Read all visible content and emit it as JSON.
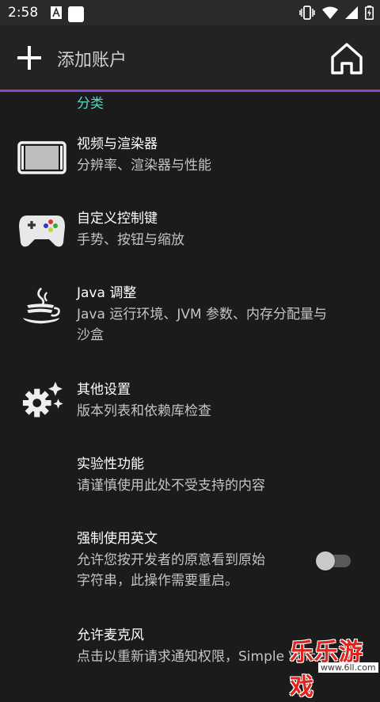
{
  "status_bar": {
    "time": "2:58"
  },
  "app_bar": {
    "title": "添加账户"
  },
  "category": "分类",
  "settings": [
    {
      "title": "视频与渲染器",
      "summary": "分辨率、渲染器与性能",
      "icon": "display-icon"
    },
    {
      "title": "自定义控制键",
      "summary": "手势、按钮与缩放",
      "icon": "gamepad-icon"
    },
    {
      "title": "Java 调整",
      "summary_lines": [
        "Java 运行环境、JVM 参数、内存分配量与",
        "沙盒"
      ],
      "icon": "java-cup-icon"
    },
    {
      "title": "其他设置",
      "summary": "版本列表和依赖库检查",
      "icon": "gear-sparkle-icon"
    },
    {
      "title": "实验性功能",
      "summary": "请谨慎使用此处不受支持的内容"
    },
    {
      "title": "强制使用英文",
      "summary_lines": [
        "允许您按开发者的原意看到原始",
        "字符串，此操作需要重启。"
      ],
      "switch_on": false
    },
    {
      "title": "允许麦克风",
      "summary": "点击以重新请求通知权限，Simple Voice"
    }
  ],
  "watermark": {
    "text": "乐乐游戏",
    "url": "www.6ll.com"
  }
}
